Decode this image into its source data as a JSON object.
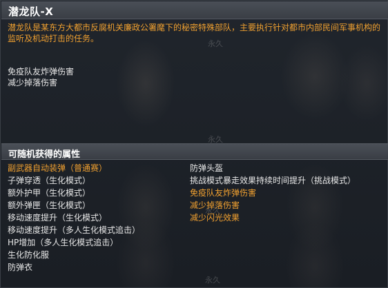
{
  "title": "潜龙队-X",
  "description": "潜龙队是某东方大都市反腐机关廉政公署麾下的秘密特殊部队，主要执行针对都市内部民间军事机构的监听及机动打击的任务。",
  "effects": [
    "免疫队友炸弹伤害",
    "减少掉落伤害"
  ],
  "watermarks": [
    "永久",
    "永久",
    "永久",
    "永久"
  ],
  "random_attributes": {
    "title": "可随机获得的属性",
    "left": [
      {
        "label": "副武器自动装弹（普通赛）",
        "color": "#f0a030"
      },
      {
        "label": "子弹穿透（生化模式）",
        "color": "#e8e8e8"
      },
      {
        "label": "额外护甲（生化模式）",
        "color": "#e8e8e8"
      },
      {
        "label": "额外弹匣（生化模式）",
        "color": "#e8e8e8"
      },
      {
        "label": "移动速度提升（生化模式）",
        "color": "#e8e8e8"
      },
      {
        "label": "移动速度提升（多人生化模式追击）",
        "color": "#e8e8e8"
      },
      {
        "label": "HP增加（多人生化模式追击）",
        "color": "#e8e8e8"
      },
      {
        "label": "生化防化服",
        "color": "#e8e8e8"
      },
      {
        "label": "防弹衣",
        "color": "#e8e8e8"
      }
    ],
    "right": [
      {
        "label": "防弹头盔",
        "color": "#e8e8e8"
      },
      {
        "label": "挑战模式暴走效果持续时间提升（挑战模式）",
        "color": "#e8e8e8"
      },
      {
        "label": "免疫队友炸弹伤害",
        "color": "#f0a030"
      },
      {
        "label": "减少掉落伤害",
        "color": "#f0a030"
      },
      {
        "label": "减少闪光效果",
        "color": "#f0a030"
      }
    ]
  }
}
